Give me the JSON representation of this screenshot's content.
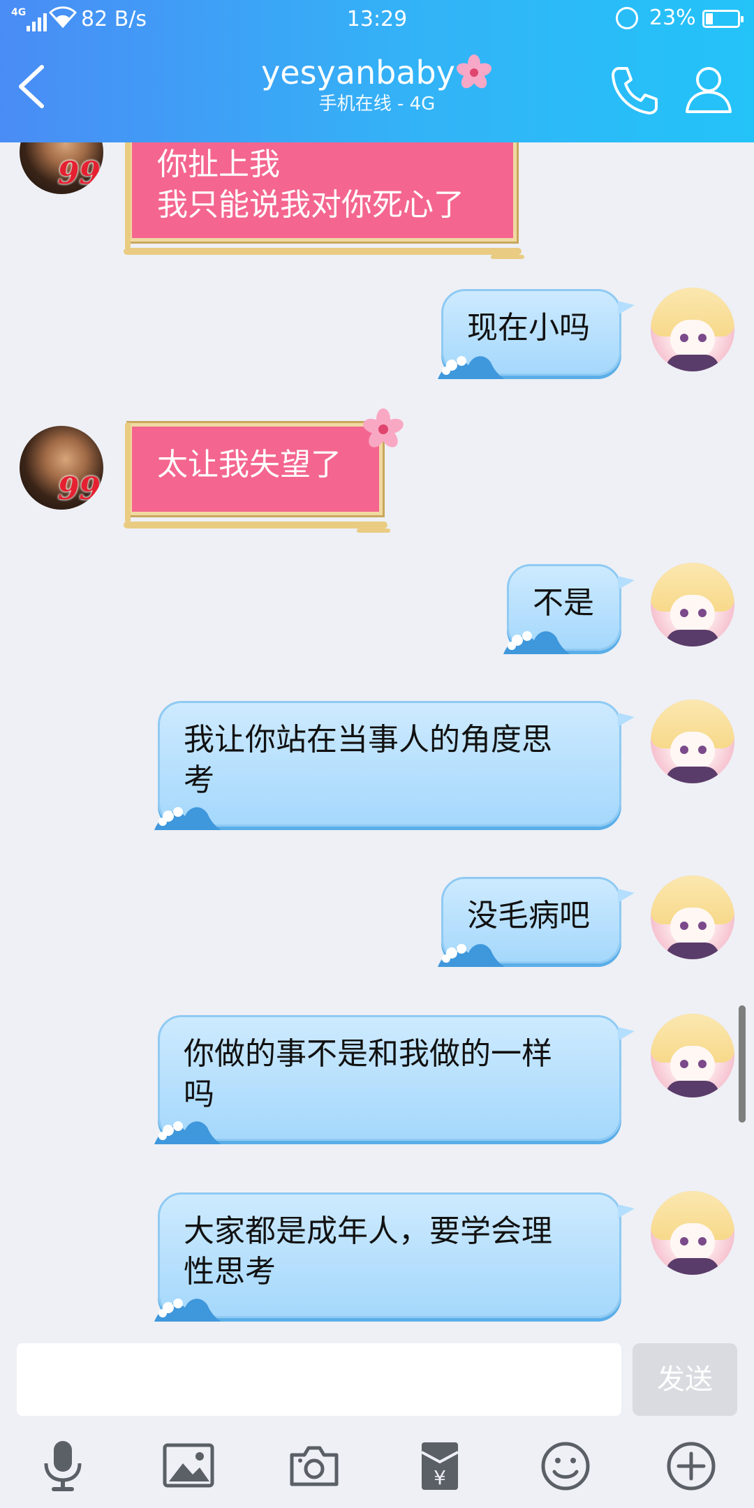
{
  "status_bar": {
    "network": "4G",
    "speed": "82 B/s",
    "time": "13:29",
    "battery": "23%",
    "battery_level": 0.23
  },
  "header": {
    "title": "yesyanbaby",
    "subtitle": "手机在线 - 4G"
  },
  "messages": [
    {
      "side": "left",
      "text": "你扯上我\n我只能说我对你死心了"
    },
    {
      "side": "right",
      "text": "现在小吗"
    },
    {
      "side": "left",
      "text": "太让我失望了"
    },
    {
      "side": "right",
      "text": "不是"
    },
    {
      "side": "right",
      "text": "我让你站在当事人的角度思\n考"
    },
    {
      "side": "right",
      "text": "没毛病吧"
    },
    {
      "side": "right",
      "text": "你做的事不是和我做的一样\n吗"
    },
    {
      "side": "right",
      "text": "大家都是成年人，要学会理\n性思考"
    }
  ],
  "input": {
    "placeholder": "",
    "send_label": "发送"
  },
  "toolbar": [
    "microphone-icon",
    "image-icon",
    "camera-icon",
    "red-packet-icon",
    "emoji-icon",
    "plus-icon"
  ],
  "colors": {
    "header_start": "#4a8cf5",
    "header_end": "#23c3f8",
    "right_bubble": "#a5d8fc",
    "left_bubble": "#f4668f",
    "gold_frame": "#e9cc82"
  }
}
